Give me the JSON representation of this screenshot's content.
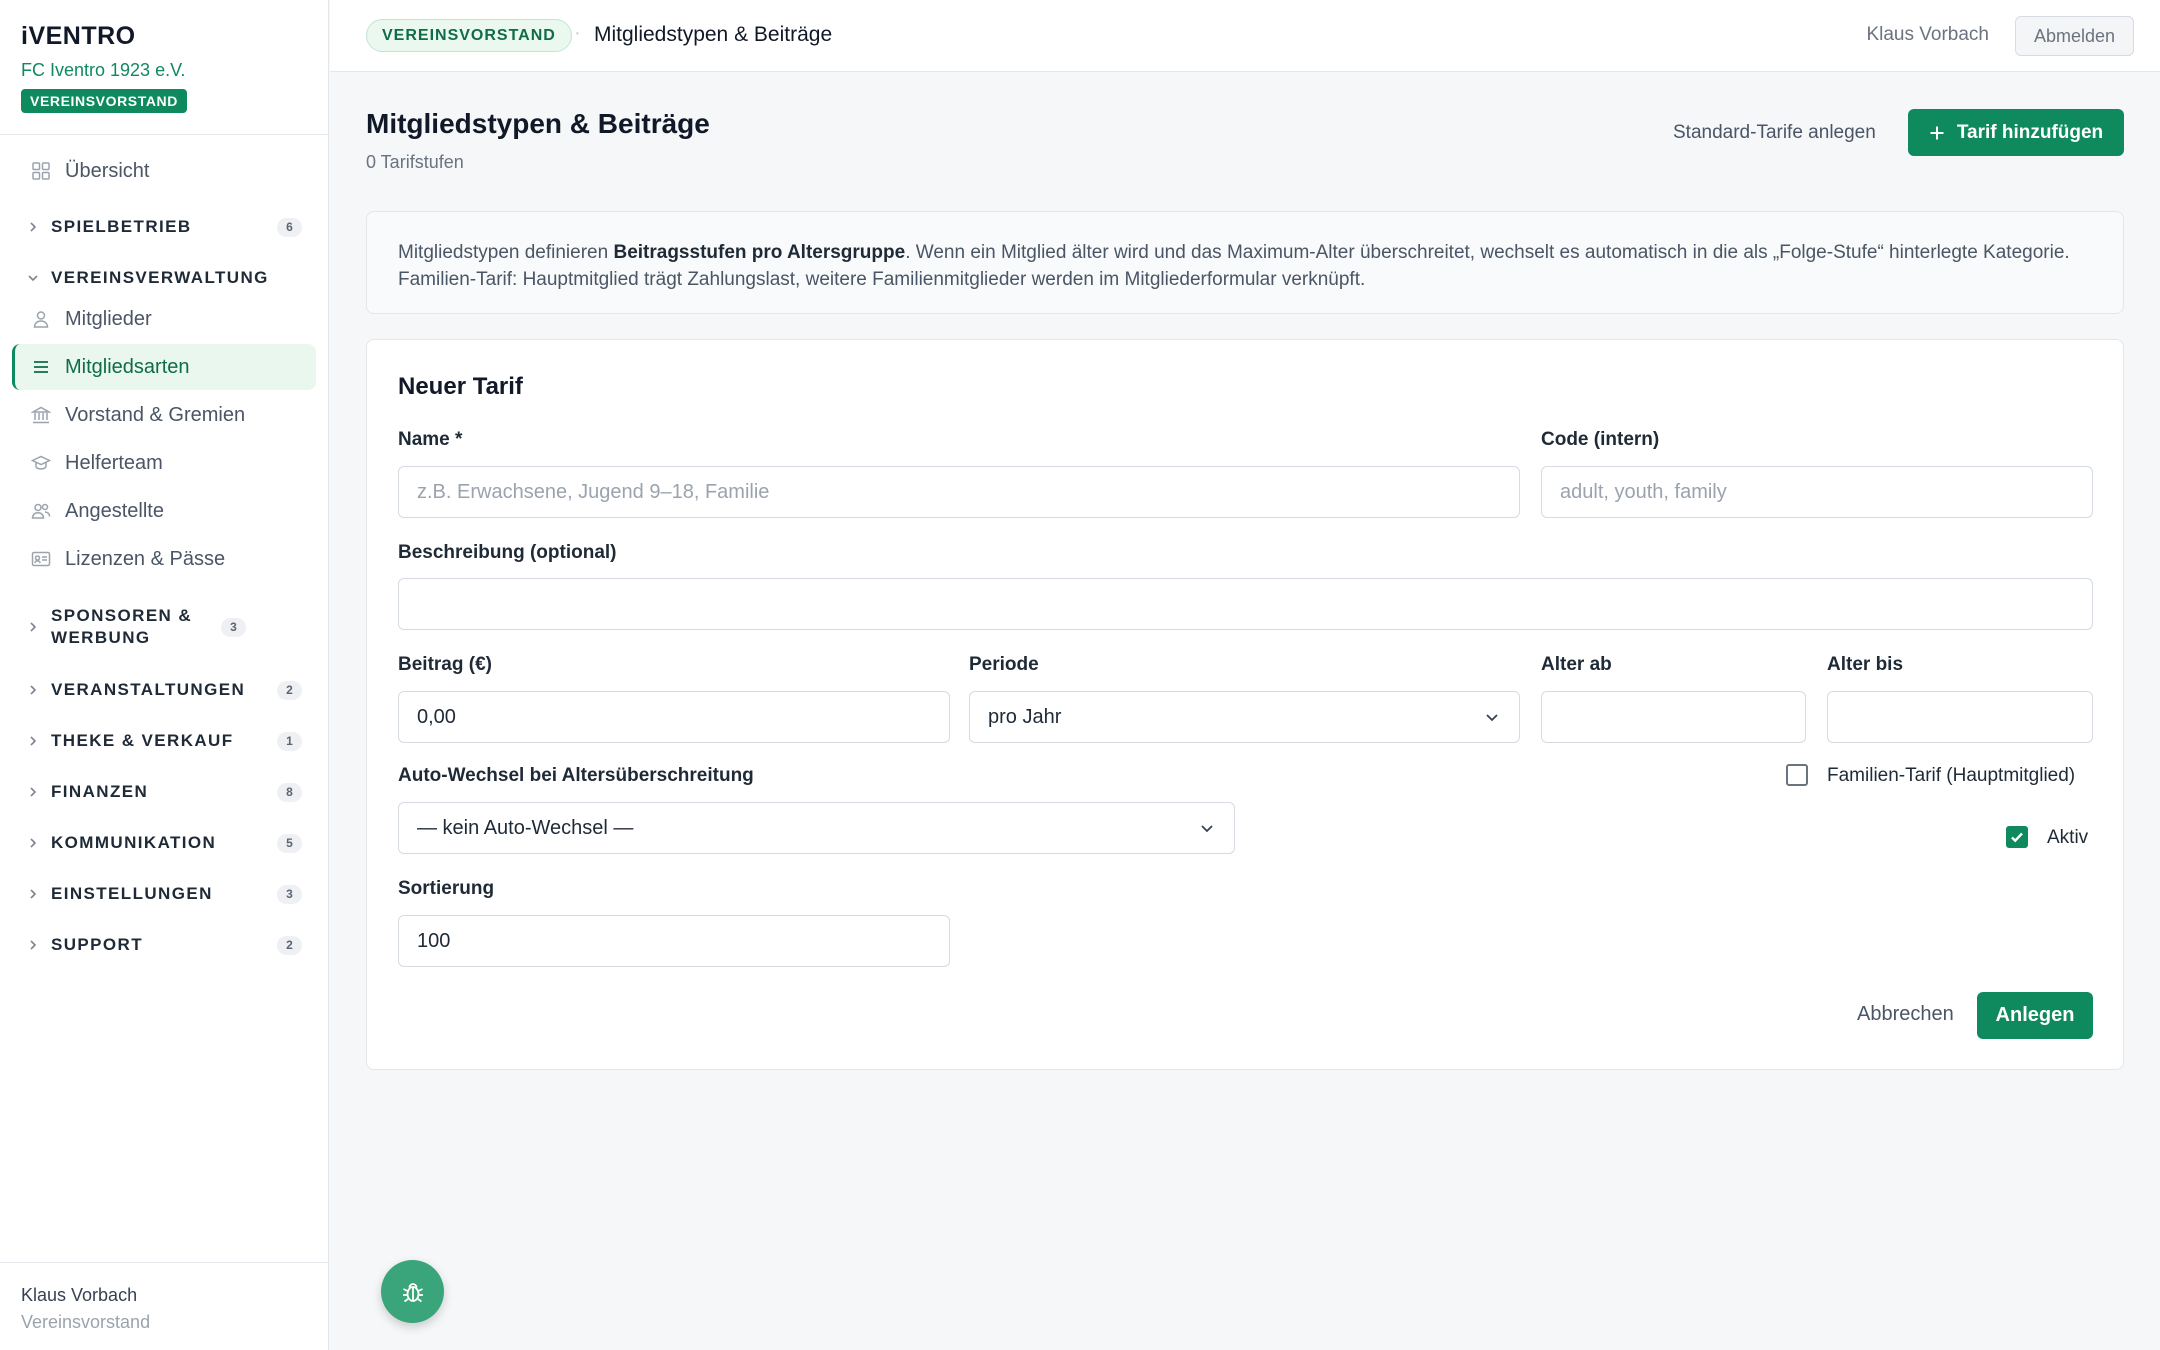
{
  "app": {
    "brand": "iVENTRO",
    "club": "FC Iventro 1923 e.V.",
    "role_badge": "VEREINSVORSTAND"
  },
  "sidebar": {
    "overview": {
      "label": "Übersicht",
      "icon": "grid-icon"
    },
    "sections": [
      {
        "label": "SPIELBETRIEB",
        "count": "6",
        "expanded": false
      },
      {
        "label": "VEREINSVERWALTUNG",
        "expanded": true
      },
      {
        "label": "SPONSOREN & WERBUNG",
        "count": "3",
        "expanded": false
      },
      {
        "label": "VERANSTALTUNGEN",
        "count": "2",
        "expanded": false
      },
      {
        "label": "THEKE & VERKAUF",
        "count": "1",
        "expanded": false
      },
      {
        "label": "FINANZEN",
        "count": "8",
        "expanded": false
      },
      {
        "label": "KOMMUNIKATION",
        "count": "5",
        "expanded": false
      },
      {
        "label": "EINSTELLUNGEN",
        "count": "3",
        "expanded": false
      },
      {
        "label": "SUPPORT",
        "count": "2",
        "expanded": false
      }
    ],
    "vereinsverwaltung_items": [
      {
        "label": "Mitglieder",
        "icon": "user-icon",
        "active": false
      },
      {
        "label": "Mitgliedsarten",
        "icon": "list-icon",
        "active": true
      },
      {
        "label": "Vorstand & Gremien",
        "icon": "bank-icon",
        "active": false
      },
      {
        "label": "Helferteam",
        "icon": "graduation-cap-icon",
        "active": false
      },
      {
        "label": "Angestellte",
        "icon": "users-icon",
        "active": false
      },
      {
        "label": "Lizenzen & Pässe",
        "icon": "id-card-icon",
        "active": false
      }
    ],
    "footer": {
      "name": "Klaus Vorbach",
      "role": "Vereinsvorstand"
    }
  },
  "topbar": {
    "badge": "VEREINSVORSTAND",
    "separator": "·",
    "page": "Mitgliedstypen & Beiträge",
    "user": "Klaus Vorbach",
    "logout": "Abmelden"
  },
  "main": {
    "title": "Mitgliedstypen & Beiträge",
    "subtitle": "0 Tarifstufen",
    "standard_tariffs": "Standard-Tarife anlegen",
    "add_tariff": "Tarif hinzufügen",
    "info": {
      "part1": "Mitgliedstypen definieren ",
      "bold": "Beitragsstufen pro Altersgruppe",
      "part2": ". Wenn ein Mitglied älter wird und das Maximum-Alter überschreitet, wechselt es automatisch in die als „Folge-Stufe“ hinterlegte Kategorie. Familien-Tarif: Hauptmitglied trägt Zahlungslast, weitere Familienmitglieder werden im Mitgliederformular verknüpft."
    }
  },
  "form": {
    "title": "Neuer Tarif",
    "name": {
      "label": "Name *",
      "placeholder": "z.B. Erwachsene, Jugend 9–18, Familie",
      "value": ""
    },
    "code": {
      "label": "Code (intern)",
      "placeholder": "adult, youth, family",
      "value": ""
    },
    "description": {
      "label": "Beschreibung (optional)",
      "value": ""
    },
    "fee": {
      "label": "Beitrag (€)",
      "value": "0,00"
    },
    "period": {
      "label": "Periode",
      "value": "pro Jahr"
    },
    "age_from": {
      "label": "Alter ab",
      "value": ""
    },
    "age_to": {
      "label": "Alter bis",
      "value": ""
    },
    "auto_switch": {
      "label": "Auto-Wechsel bei Altersüberschreitung",
      "value": "— kein Auto-Wechsel —"
    },
    "family_tariff": {
      "label": "Familien-Tarif (Hauptmitglied)",
      "checked": false
    },
    "active": {
      "label": "Aktiv",
      "checked": true
    },
    "sort": {
      "label": "Sortierung",
      "value": "100"
    },
    "cancel": "Abbrechen",
    "submit": "Anlegen"
  },
  "colors": {
    "brand_green": "#0f8a5f",
    "active_bg": "#e9f7ef",
    "fab": "#3aa47a"
  },
  "fab_icon": "bug-icon"
}
